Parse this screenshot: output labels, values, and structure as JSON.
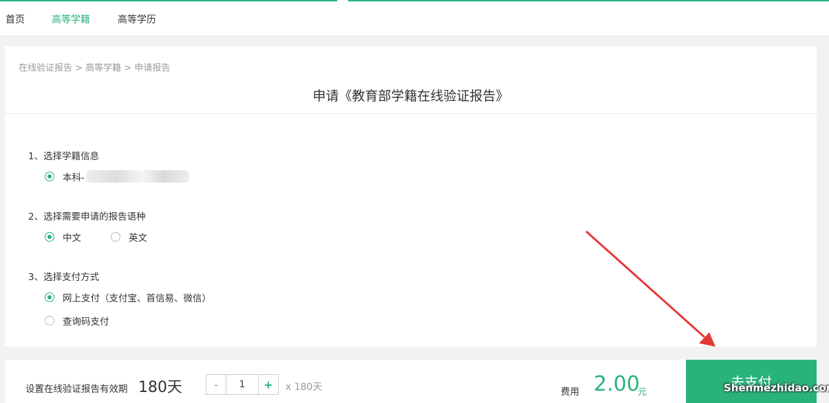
{
  "nav": {
    "home": "首页",
    "higher_enrollment": "高等学籍",
    "higher_education": "高等学历"
  },
  "breadcrumb": "在线验证报告 > 高等学籍 > 申请报告",
  "page_title": "申请《教育部学籍在线验证报告》",
  "sections": {
    "enrollment": {
      "title": "1、选择学籍信息",
      "option": "本科-"
    },
    "language": {
      "title": "2、选择需要申请的报告语种",
      "options": [
        "中文",
        "英文"
      ],
      "selected": "中文"
    },
    "payment": {
      "title": "3、选择支付方式",
      "options": [
        "网上支付（支付宝、首信易、微信）",
        "查询码支付"
      ],
      "selected": "网上支付（支付宝、首信易、微信）"
    }
  },
  "bottom": {
    "validity_label": "设置在线验证报告有效期",
    "validity_value": "180天",
    "stepper_minus": "-",
    "stepper_value": "1",
    "stepper_plus": "+",
    "multiplier": "x 180天",
    "fee_label": "费用",
    "fee_amount": "2.00",
    "fee_unit": "元",
    "pay_button": "去支付"
  },
  "watermark": "Shenmezhidao.com",
  "colors": {
    "accent": "#2ab27b",
    "annotation_arrow": "#e53935"
  }
}
